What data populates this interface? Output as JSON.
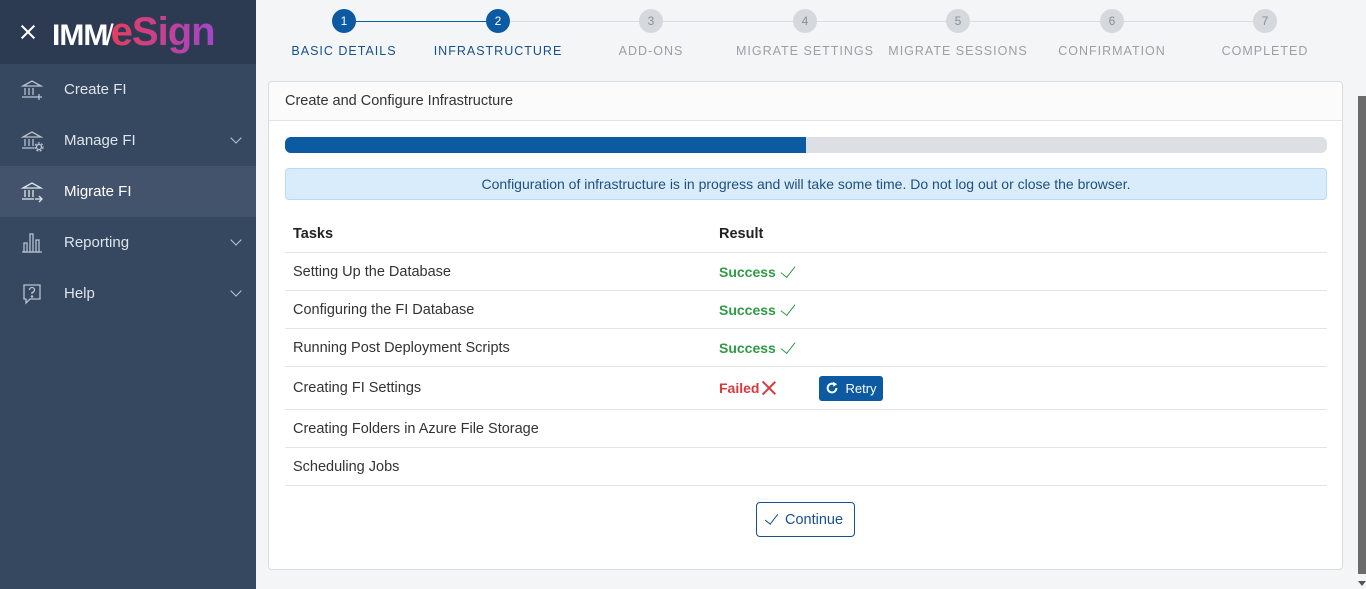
{
  "brand": {
    "imm": "IMM",
    "slash": "/",
    "esign": "eSign"
  },
  "sidebar": {
    "items": [
      {
        "label": "Create FI",
        "icon": "bank-plus-icon",
        "has_chevron": false,
        "active": false
      },
      {
        "label": "Manage FI",
        "icon": "bank-gear-icon",
        "has_chevron": true,
        "active": false
      },
      {
        "label": "Migrate FI",
        "icon": "bank-arrow-icon",
        "has_chevron": false,
        "active": true
      },
      {
        "label": "Reporting",
        "icon": "bar-chart-icon",
        "has_chevron": true,
        "active": false
      },
      {
        "label": "Help",
        "icon": "help-bubble-icon",
        "has_chevron": true,
        "active": false
      }
    ]
  },
  "stepper": {
    "steps": [
      {
        "num": "1",
        "label": "BASIC DETAILS",
        "state": "done"
      },
      {
        "num": "2",
        "label": "INFRASTRUCTURE",
        "state": "done"
      },
      {
        "num": "3",
        "label": "ADD-ONS",
        "state": "todo"
      },
      {
        "num": "4",
        "label": "MIGRATE SETTINGS",
        "state": "todo"
      },
      {
        "num": "5",
        "label": "MIGRATE SESSIONS",
        "state": "todo"
      },
      {
        "num": "6",
        "label": "CONFIRMATION",
        "state": "todo"
      },
      {
        "num": "7",
        "label": "COMPLETED",
        "state": "todo"
      }
    ]
  },
  "card": {
    "title": "Create and Configure Infrastructure",
    "progress_percent": 50,
    "alert": "Configuration of infrastructure is in progress and will take some time. Do not log out or close the browser."
  },
  "table": {
    "headers": {
      "tasks": "Tasks",
      "result": "Result"
    },
    "rows": [
      {
        "task": "Setting Up the Database",
        "result": "Success",
        "status": "success"
      },
      {
        "task": "Configuring the FI Database",
        "result": "Success",
        "status": "success"
      },
      {
        "task": "Running Post Deployment Scripts",
        "result": "Success",
        "status": "success"
      },
      {
        "task": "Creating FI Settings",
        "result": "Failed",
        "status": "failed",
        "action": "Retry"
      },
      {
        "task": "Creating Folders in Azure File Storage",
        "result": "",
        "status": "pending"
      },
      {
        "task": "Scheduling Jobs",
        "result": "",
        "status": "pending"
      }
    ]
  },
  "continue_label": "Continue",
  "colors": {
    "primary": "#0b5aa2",
    "success": "#2f9a45",
    "danger": "#d8383f",
    "sidebar": "#364760"
  }
}
